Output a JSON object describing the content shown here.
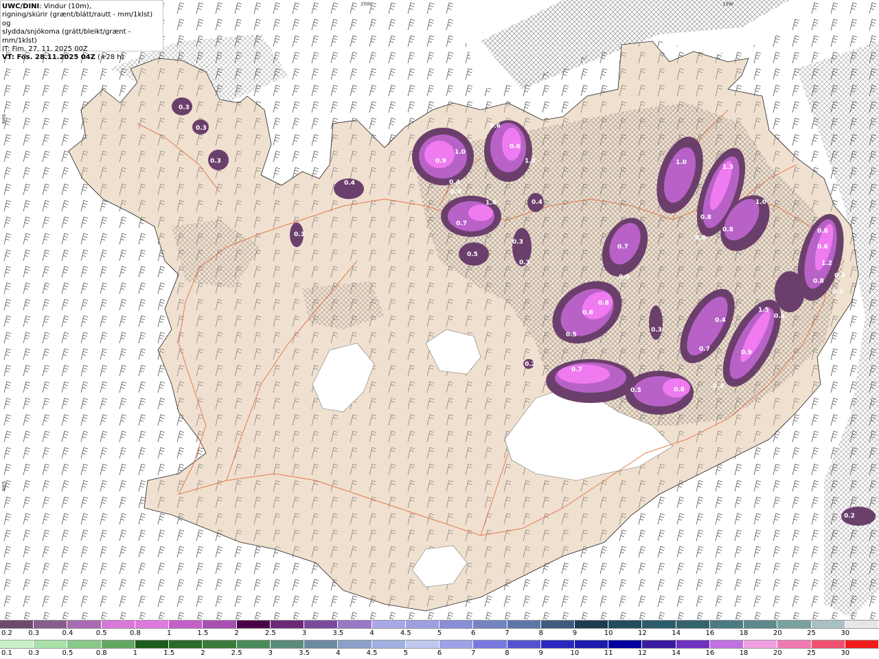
{
  "header": {
    "product": "UWC/DINI",
    "desc1": ": Vindur (10m),",
    "desc2": "rigning/skúrir (grænt/blátt/rautt - mm/1klst) og",
    "desc3": "slydda/snjókoma (grátt/bleikt/grænt - mm/1klst)",
    "it": "IT: Fim. 27. 11. 2025 00Z",
    "vt_label": "VT: Fös. 28.11.2025 04Z",
    "vt_offset": " (+28 h)"
  },
  "graticule": {
    "lon_labels": [
      "20W",
      "15W"
    ],
    "lat_labels": [
      "N66",
      "N65"
    ]
  },
  "map_labels": [
    "0.3",
    "0.3",
    "0.3",
    "0.4",
    "0.3",
    "1.0",
    "0.9",
    "0.4",
    "0.4",
    "0.6",
    "0.6",
    "1.0",
    "1.4",
    "0.7",
    "0.5",
    "0.4",
    "0.3",
    "0.3",
    "1.0",
    "1.3",
    "1.0",
    "0.8",
    "0.6",
    "0.8",
    "0.7",
    "0.5",
    "0.8",
    "0.8",
    "0.5",
    "0.3",
    "0.4",
    "0.7",
    "1.5",
    "0.4",
    "0.9",
    "0.7",
    "0.4",
    "0.5",
    "0.8",
    "0.2",
    "0.8",
    "0.6",
    "1.2",
    "0.8",
    "0.3",
    "0.3",
    "0.2"
  ],
  "colors": {
    "land": "#f0e0cf",
    "roads": "#e06a3a",
    "barbs": "#555555",
    "precip_dark": "#6b3f6b",
    "precip_mid": "#b862c8",
    "precip_light": "#f07af0"
  },
  "legend": {
    "top_colors": [
      "#6c4a70",
      "#885d8c",
      "#a86ab0",
      "#d878d8",
      "#e078e0",
      "#c260c8",
      "#a850b0",
      "#4a0048",
      "#6a2a78",
      "#7c4a9c",
      "#9a78c8",
      "#a8a8e8",
      "#9ca0e0",
      "#8a8ed8",
      "#7384c0",
      "#5c76a8",
      "#3f5c80",
      "#1e3c50",
      "#244c5c",
      "#2c5c6a",
      "#35646e",
      "#4b7a84",
      "#5c8a8c",
      "#7aa0a0",
      "#a9c0c0",
      "#e6e6e6"
    ],
    "top_labels": [
      "0.2",
      "0.3",
      "0.4",
      "0.5",
      "0.8",
      "1",
      "1.5",
      "2",
      "2.5",
      "3",
      "3.5",
      "4",
      "4.5",
      "5",
      "6",
      "7",
      "8",
      "9",
      "10",
      "12",
      "14",
      "16",
      "18",
      "20",
      "25",
      "30"
    ],
    "bottom_colors": [
      "#c8f0c8",
      "#a8e0a8",
      "#88c888",
      "#62a862",
      "#1c5c1c",
      "#2a6a2a",
      "#3a7a3a",
      "#4a8a5a",
      "#5a8a7a",
      "#6a8aa0",
      "#8aa0c8",
      "#a0b0e0",
      "#c0c8f0",
      "#a0a0e8",
      "#7878e0",
      "#5454d0",
      "#2828c0",
      "#1c1cb0",
      "#0000a0",
      "#3a1ca0",
      "#7030c0",
      "#c070e0",
      "#f0a0e0",
      "#f07ab0",
      "#f05070",
      "#f01c1c"
    ],
    "bottom_labels": [
      "0.1",
      "0.3",
      "0.5",
      "0.8",
      "1",
      "1.5",
      "2",
      "2.5",
      "3",
      "3.5",
      "4",
      "4.5",
      "5",
      "6",
      "7",
      "8",
      "9",
      "10",
      "11",
      "12",
      "14",
      "16",
      "18",
      "20",
      "25",
      "30"
    ]
  }
}
